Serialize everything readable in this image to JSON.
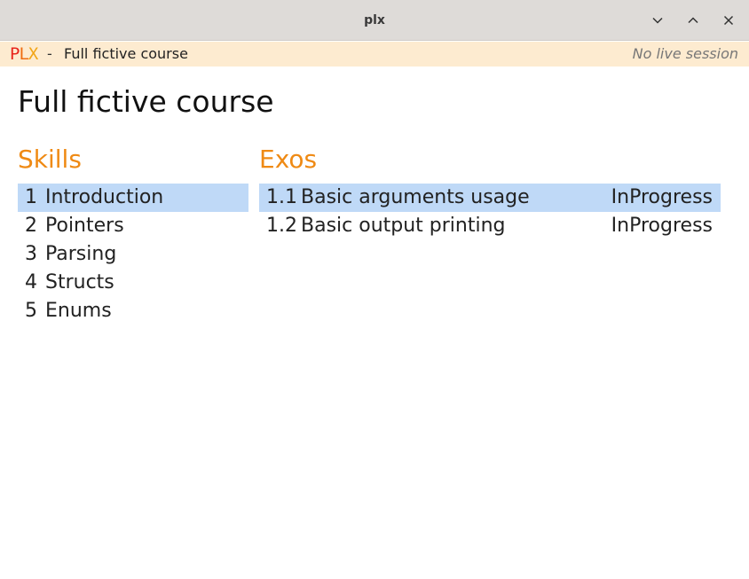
{
  "window": {
    "title": "plx",
    "buttons": [
      {
        "name": "minimize-icon"
      },
      {
        "name": "maximize-icon"
      },
      {
        "name": "close-icon"
      }
    ]
  },
  "header": {
    "logo": {
      "p": "P",
      "l": "L",
      "x": "X"
    },
    "separator": "-",
    "course_name": "Full fictive course",
    "live_status": "No live session",
    "background": "#fdebd0"
  },
  "main": {
    "title": "Full fictive course",
    "skills": {
      "heading": "Skills",
      "items": [
        {
          "num": "1",
          "label": "Introduction",
          "selected": true
        },
        {
          "num": "2",
          "label": "Pointers",
          "selected": false
        },
        {
          "num": "3",
          "label": "Parsing",
          "selected": false
        },
        {
          "num": "4",
          "label": "Structs",
          "selected": false
        },
        {
          "num": "5",
          "label": "Enums",
          "selected": false
        }
      ]
    },
    "exos": {
      "heading": "Exos",
      "items": [
        {
          "num": "1.1",
          "label": "Basic arguments usage",
          "state": "InProgress",
          "selected": true
        },
        {
          "num": "1.2",
          "label": "Basic output printing",
          "state": "InProgress",
          "selected": false
        }
      ]
    }
  },
  "colors": {
    "accent": "#ef8a14",
    "selection": "#bfd9f7",
    "logo_p": "#e8251c",
    "logo_l": "#ef6c10",
    "logo_x": "#f2a516"
  }
}
